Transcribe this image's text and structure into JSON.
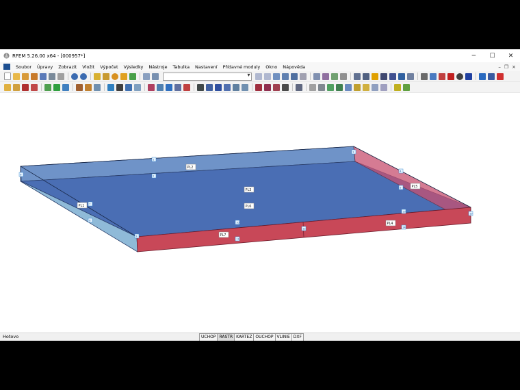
{
  "window": {
    "title": "RFEM 5.26.00 x64 - [000957*]",
    "controls": {
      "minimize": "─",
      "maximize": "☐",
      "close": "✕"
    }
  },
  "menu": {
    "items": [
      "Soubor",
      "Úpravy",
      "Zobrazit",
      "Vložit",
      "Výpočet",
      "Výsledky",
      "Nástroje",
      "Tabulka",
      "Nastavení",
      "Přídavné moduly",
      "Okno",
      "Nápověda"
    ],
    "mdi_controls": {
      "minimize": "–",
      "restore": "❐",
      "close": "×"
    }
  },
  "toolbar": {
    "combo_value": ""
  },
  "model": {
    "surface_labels": [
      "PL2",
      "PL3",
      "PL6",
      "PL5",
      "PL1",
      "PL7",
      "PL4"
    ],
    "colors": {
      "top": "#4a6eb4",
      "back": "#6f93c8",
      "left": "#8fbad8",
      "front": "#c84858",
      "right": "#c85070"
    }
  },
  "status": {
    "text": "Hotovo",
    "buttons": [
      "UCHOP",
      "RASTR",
      "KARTEZ",
      "OUCHOP",
      "VLINIE",
      "DXF"
    ]
  }
}
